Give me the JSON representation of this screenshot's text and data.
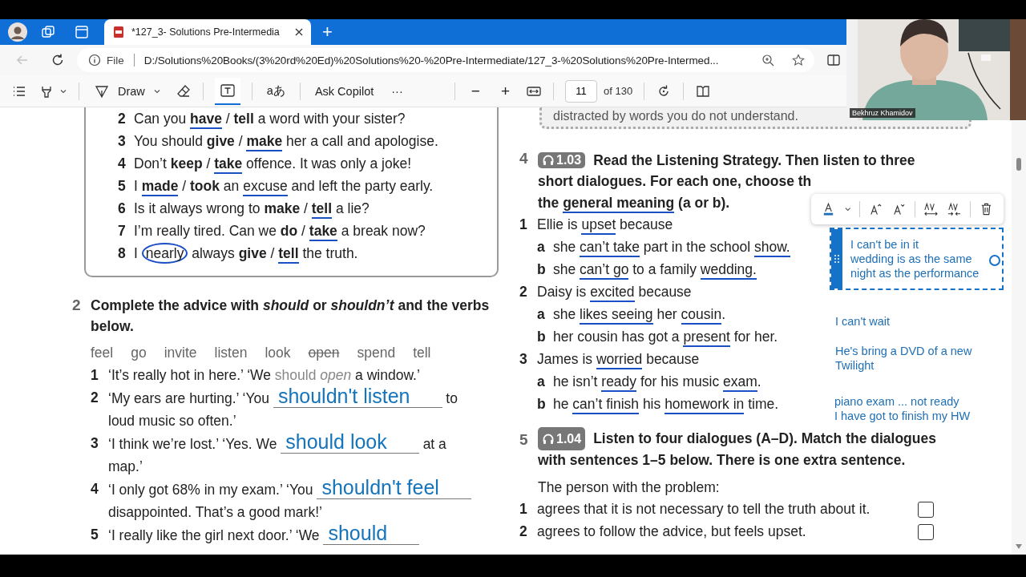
{
  "browser": {
    "tabs": [
      {
        "title": "*127_3- Solutions Pre-Intermedia",
        "selected": true
      }
    ],
    "new_tab": "+",
    "back_disabled": true,
    "address": {
      "scheme": "File",
      "url": "D:/Solutions%20Books/(3%20rd%20Ed)%20Solutions%20-%20Pre-Intermediate/127_3-%20Solutions%20Pre-Intermed..."
    }
  },
  "pdf_toolbar": {
    "draw": "Draw",
    "read_aloud": "aあ",
    "copilot": "Ask Copilot",
    "more": "···",
    "zoom_out": "−",
    "zoom_in": "+",
    "page": "11",
    "page_count": "of 130",
    "text_tool_selected": true
  },
  "webcam": {
    "name": "Bekhruz Khamidov"
  },
  "exercise_1": {
    "items": [
      {
        "number": "2",
        "segments": [
          {
            "text": "Can you ",
            "kind": "plain"
          },
          {
            "text": "have",
            "kind": "bold-ink"
          },
          {
            "text": " / ",
            "kind": "plain"
          },
          {
            "text": "tell",
            "kind": "bold"
          },
          {
            "text": " a word with your sister?",
            "kind": "plain"
          }
        ]
      },
      {
        "number": "3",
        "segments": [
          {
            "text": "You should ",
            "kind": "plain"
          },
          {
            "text": "give",
            "kind": "bold"
          },
          {
            "text": " / ",
            "kind": "plain"
          },
          {
            "text": "make",
            "kind": "bold-ink"
          },
          {
            "text": " her a call and apologise.",
            "kind": "plain"
          }
        ]
      },
      {
        "number": "4",
        "segments": [
          {
            "text": "Don’t ",
            "kind": "plain"
          },
          {
            "text": "keep",
            "kind": "bold"
          },
          {
            "text": " / ",
            "kind": "plain"
          },
          {
            "text": "take",
            "kind": "bold-ink"
          },
          {
            "text": " offence. It was only a joke!",
            "kind": "plain"
          }
        ]
      },
      {
        "number": "5",
        "segments": [
          {
            "text": "I ",
            "kind": "plain"
          },
          {
            "text": "made",
            "kind": "bold-ink"
          },
          {
            "text": " / ",
            "kind": "plain"
          },
          {
            "text": "took",
            "kind": "bold"
          },
          {
            "text": " an ",
            "kind": "plain"
          },
          {
            "text": "excuse",
            "kind": "ink"
          },
          {
            "text": " and left the party early.",
            "kind": "plain"
          }
        ]
      },
      {
        "number": "6",
        "segments": [
          {
            "text": "Is it always wrong to ",
            "kind": "plain"
          },
          {
            "text": "make",
            "kind": "bold"
          },
          {
            "text": " / ",
            "kind": "plain"
          },
          {
            "text": "tell",
            "kind": "bold-ink"
          },
          {
            "text": " a lie?",
            "kind": "plain"
          }
        ]
      },
      {
        "number": "7",
        "segments": [
          {
            "text": "I’m really tired. Can we ",
            "kind": "plain"
          },
          {
            "text": "do",
            "kind": "bold"
          },
          {
            "text": " / ",
            "kind": "plain"
          },
          {
            "text": "take",
            "kind": "bold-ink"
          },
          {
            "text": " a break now?",
            "kind": "plain"
          }
        ]
      },
      {
        "number": "8",
        "segments": [
          {
            "text": "I ",
            "kind": "plain"
          },
          {
            "text": "nearly",
            "kind": "circle"
          },
          {
            "text": " always ",
            "kind": "plain"
          },
          {
            "text": "give",
            "kind": "bold"
          },
          {
            "text": " / ",
            "kind": "plain"
          },
          {
            "text": "tell",
            "kind": "bold-ink"
          },
          {
            "text": " the truth.",
            "kind": "plain"
          }
        ]
      }
    ]
  },
  "exercise_2": {
    "number": "2",
    "instruction": "Complete the advice with *should* or *shouldn’t* and the verbs below.",
    "words": [
      {
        "text": "feel",
        "crossed": false
      },
      {
        "text": "go",
        "crossed": false
      },
      {
        "text": "invite",
        "crossed": false
      },
      {
        "text": "listen",
        "crossed": false
      },
      {
        "text": "look",
        "crossed": false
      },
      {
        "text": "open",
        "crossed": true
      },
      {
        "text": "spend",
        "crossed": false
      },
      {
        "text": "tell",
        "crossed": false
      }
    ],
    "items": [
      {
        "number": "1",
        "segments": [
          {
            "text": "‘It’s really hot in here.’ ‘We ",
            "kind": "plain"
          },
          {
            "text": "should",
            "kind": "hint"
          },
          {
            "text": " open",
            "kind": "hint-italic"
          },
          {
            "text": " a window.’",
            "kind": "plain"
          }
        ]
      },
      {
        "number": "2",
        "segments": [
          {
            "text": "‘My ears are hurting.’ ‘You ",
            "kind": "plain"
          },
          {
            "text": "shouldn't listen",
            "kind": "answer"
          },
          {
            "text": " to loud music so often.’",
            "kind": "plain"
          }
        ]
      },
      {
        "number": "3",
        "segments": [
          {
            "text": "‘I think we’re lost.’ ‘Yes. We ",
            "kind": "plain"
          },
          {
            "text": "should look",
            "kind": "answer"
          },
          {
            "text": " at a map.’",
            "kind": "plain"
          }
        ]
      },
      {
        "number": "4",
        "segments": [
          {
            "text": "‘I only got 68% in my exam.’ ‘You ",
            "kind": "plain"
          },
          {
            "text": "shouldn't feel",
            "kind": "answer"
          },
          {
            "text": " disappointed. That’s a good mark!’",
            "kind": "plain"
          }
        ]
      },
      {
        "number": "5",
        "segments": [
          {
            "text": "‘I really like the girl next door.’ ‘We ",
            "kind": "plain"
          },
          {
            "text": "should",
            "kind": "answer"
          }
        ]
      }
    ]
  },
  "tip_box": {
    "text": "distracted by words you do not understand."
  },
  "exercise_4": {
    "number": "4",
    "audio": "1.03",
    "heading_lines": [
      [
        {
          "text": "Read the Listening Strategy. Then listen to three",
          "kind": "plain"
        }
      ],
      [
        {
          "text": "short dialogues. For each one, choose th",
          "kind": "plain"
        }
      ],
      [
        {
          "text": "the ",
          "kind": "plain"
        },
        {
          "text": "general meaning",
          "kind": "ink"
        },
        {
          "text": " (a or b).",
          "kind": "plain"
        }
      ]
    ],
    "items": [
      {
        "number": "1",
        "segments": [
          {
            "text": "Ellie is ",
            "kind": "plain"
          },
          {
            "text": "upset",
            "kind": "ink"
          },
          {
            "text": " because",
            "kind": "plain"
          }
        ],
        "options": [
          {
            "letter": "a",
            "segments": [
              {
                "text": "she ",
                "kind": "plain"
              },
              {
                "text": "can’t take",
                "kind": "ink"
              },
              {
                "text": " part in the school ",
                "kind": "plain"
              },
              {
                "text": "show.",
                "kind": "ink"
              }
            ]
          },
          {
            "letter": "b",
            "segments": [
              {
                "text": "she ",
                "kind": "plain"
              },
              {
                "text": "can’t go",
                "kind": "ink"
              },
              {
                "text": " to a family ",
                "kind": "plain"
              },
              {
                "text": "wedding.",
                "kind": "ink"
              }
            ]
          }
        ]
      },
      {
        "number": "2",
        "segments": [
          {
            "text": "Daisy is ",
            "kind": "plain"
          },
          {
            "text": "excited",
            "kind": "ink"
          },
          {
            "text": " because",
            "kind": "plain"
          }
        ],
        "options": [
          {
            "letter": "a",
            "segments": [
              {
                "text": "she ",
                "kind": "plain"
              },
              {
                "text": "likes seeing",
                "kind": "ink"
              },
              {
                "text": " her ",
                "kind": "plain"
              },
              {
                "text": "cousin",
                "kind": "ink"
              },
              {
                "text": ".",
                "kind": "plain"
              }
            ]
          },
          {
            "letter": "b",
            "segments": [
              {
                "text": "her cousin has got a ",
                "kind": "plain"
              },
              {
                "text": "present",
                "kind": "ink"
              },
              {
                "text": " for her.",
                "kind": "plain"
              }
            ]
          }
        ]
      },
      {
        "number": "3",
        "segments": [
          {
            "text": "James is ",
            "kind": "plain"
          },
          {
            "text": "worried",
            "kind": "ink"
          },
          {
            "text": " because",
            "kind": "plain"
          }
        ],
        "options": [
          {
            "letter": "a",
            "segments": [
              {
                "text": "he isn’t ",
                "kind": "plain"
              },
              {
                "text": "ready",
                "kind": "ink"
              },
              {
                "text": " for his music ",
                "kind": "plain"
              },
              {
                "text": "exam",
                "kind": "ink"
              },
              {
                "text": ".",
                "kind": "plain"
              }
            ]
          },
          {
            "letter": "b",
            "segments": [
              {
                "text": "he ",
                "kind": "plain"
              },
              {
                "text": "can’t finish",
                "kind": "ink"
              },
              {
                "text": " his ",
                "kind": "plain"
              },
              {
                "text": "homework in",
                "kind": "ink"
              },
              {
                "text": " time.",
                "kind": "plain"
              }
            ]
          }
        ]
      }
    ],
    "editing_note": {
      "lines": [
        "I can't be in it",
        "wedding is as the same",
        "night as the performance"
      ]
    },
    "notes": [
      "I can't wait",
      "He's bring a DVD of a new Twilight",
      "piano exam ... not ready",
      "I have got to finish my HW"
    ]
  },
  "exercise_5": {
    "number": "5",
    "audio": "1.04",
    "instruction_lines": [
      "Listen to four dialogues (A–D). Match the dialogues",
      "with sentences 1–5 below. There is one extra sentence."
    ],
    "lead": "The person with the problem:",
    "statements": [
      {
        "number": "1",
        "text": "agrees that it is not necessary to tell the truth about it.",
        "checked": false
      },
      {
        "number": "2",
        "text": "agrees to follow the advice, but feels upset.",
        "checked": false
      }
    ]
  }
}
